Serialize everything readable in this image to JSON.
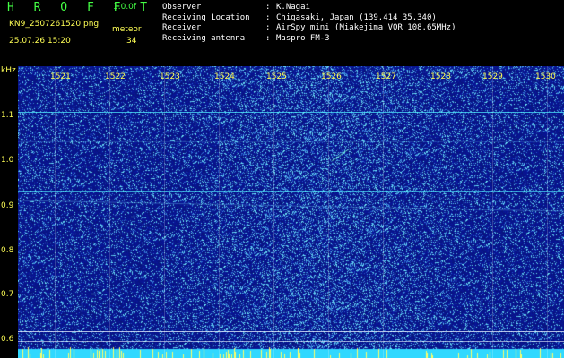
{
  "header": {
    "title": "H R O F F T",
    "version": "1.0.0f",
    "filename": "KN9_2507261520.png",
    "meteor_label": "meteor",
    "datetime": "25.07.26 15:20",
    "count": "34"
  },
  "info": [
    {
      "key": "Observer",
      "value": "K.Nagai"
    },
    {
      "key": "Receiving Location",
      "value": "Chigasaki, Japan (139.414 35.340)"
    },
    {
      "key": "Receiver",
      "value": "AirSpy mini (Miakejima VOR 108.65MHz)"
    },
    {
      "key": "Receiving antenna",
      "value": "Maspro FM-3"
    }
  ],
  "axes": {
    "y_unit": "kHz",
    "y_ticks": [
      "1.1",
      "1.0",
      "0.9",
      "0.8",
      "0.7",
      "0.6"
    ],
    "x_ticks": [
      "1521",
      "1522",
      "1523",
      "1524",
      "1525",
      "1526",
      "1527",
      "1528",
      "1529",
      "1530"
    ]
  },
  "colors": {
    "background": "#000000",
    "spectrogram_base": "#0a1a8a",
    "text_yellow": "#ffff55",
    "text_green": "#44ff44",
    "trace_cyan": "#40e0ff"
  }
}
